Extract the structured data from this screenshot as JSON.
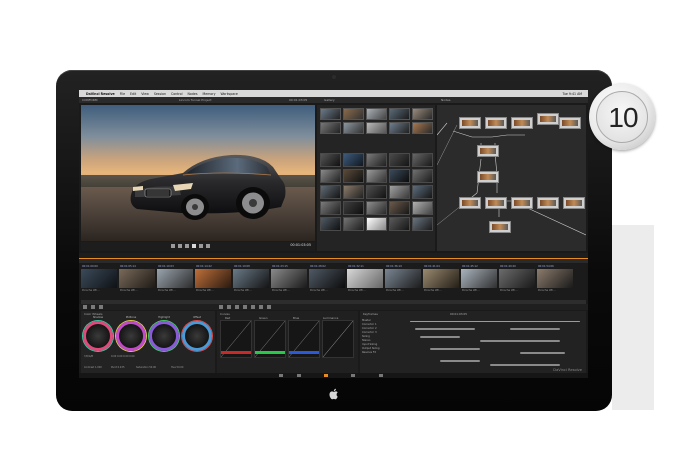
{
  "badge": {
    "text": "10"
  },
  "menubar": {
    "app_name": "DaVinci Resolve",
    "items": [
      "File",
      "Edit",
      "View",
      "Session",
      "Control",
      "Nodes",
      "Memory",
      "Workspace"
    ],
    "right": "Tue 9:41 AM"
  },
  "titlebar": {
    "left": "CONFORM",
    "center": "Lincoln Tunnel Project",
    "right": "00:01:03:05",
    "gallery_label": "Gallery",
    "nodes_label": "Nodes"
  },
  "viewer": {
    "timecode": "00:01:03:05"
  },
  "timeline": {
    "clips": [
      {
        "tc": "00:01:00:00",
        "name": "Porsche Wh..."
      },
      {
        "tc": "00:01:05:14",
        "name": "Porsche Wh..."
      },
      {
        "tc": "00:01:10:03",
        "name": "Porsche Wh..."
      },
      {
        "tc": "00:01:14:22",
        "name": "Porsche Wh..."
      },
      {
        "tc": "00:01:19:08",
        "name": "Porsche Wh..."
      },
      {
        "tc": "00:01:23:15",
        "name": "Porsche Wh..."
      },
      {
        "tc": "00:01:28:02",
        "name": "Porsche Wh..."
      },
      {
        "tc": "00:01:32:11",
        "name": "Porsche Wh..."
      },
      {
        "tc": "00:01:36:19",
        "name": "Porsche Wh..."
      },
      {
        "tc": "00:01:41:04",
        "name": "Porsche Wh..."
      },
      {
        "tc": "00:01:45:12",
        "name": "Porsche Wh..."
      },
      {
        "tc": "00:01:49:20",
        "name": "Porsche Wh..."
      },
      {
        "tc": "00:01:54:06",
        "name": "Porsche Wh..."
      }
    ]
  },
  "color_wheels": {
    "title": "Color Wheels",
    "wheels": [
      {
        "label": "Shadow",
        "ring": "#e04a7a"
      },
      {
        "label": "Midtone",
        "ring": "#c04ac8"
      },
      {
        "label": "Highlight",
        "ring": "#8b5ad8"
      },
      {
        "label": "Offset",
        "ring": "#4a9ad8"
      }
    ],
    "stats": [
      "Y/R/G/B",
      "0.00 0.00 0.00 0.00",
      "Contrast 1.000",
      "Pivot 0.435",
      "Saturation 50.00",
      "Hue 50.00"
    ]
  },
  "curves": {
    "title": "Curves",
    "channels": [
      "Red",
      "Green",
      "Blue",
      "Luminance"
    ]
  },
  "keyframes": {
    "title": "Keyframes",
    "timecode": "00:01:03:05",
    "rows": [
      "Master",
      "Corrector 1",
      "Corrector 2",
      "Corrector 3",
      "Sizing",
      "Stereo",
      "Input Sizing",
      "Output Sizing",
      "Resolve FX"
    ]
  },
  "brand": {
    "text": "DaVinci Resolve"
  },
  "colors": {
    "accent": "#e88b22"
  }
}
